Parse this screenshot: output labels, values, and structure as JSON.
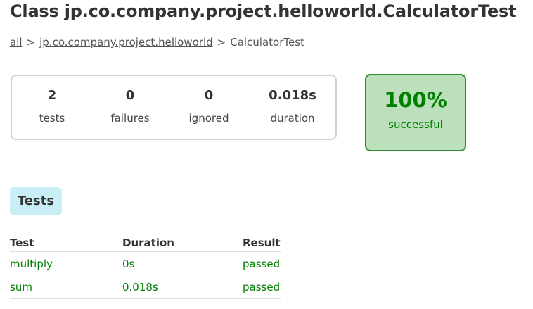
{
  "header": {
    "title": "Class jp.co.company.project.helloworld.CalculatorTest"
  },
  "breadcrumb": {
    "all": "all",
    "separator": ">",
    "package": "jp.co.company.project.helloworld",
    "current": "CalculatorTest"
  },
  "summary": {
    "counters": [
      {
        "value": "2",
        "label": "tests"
      },
      {
        "value": "0",
        "label": "failures"
      },
      {
        "value": "0",
        "label": "ignored"
      },
      {
        "value": "0.018s",
        "label": "duration"
      }
    ],
    "success": {
      "percent": "100%",
      "label": "successful"
    }
  },
  "tabs": [
    {
      "label": "Tests"
    }
  ],
  "table": {
    "headers": [
      "Test",
      "Duration",
      "Result"
    ],
    "rows": [
      {
        "test": "multiply",
        "duration": "0s",
        "result": "passed"
      },
      {
        "test": "sum",
        "duration": "0.018s",
        "result": "passed"
      }
    ]
  },
  "colors": {
    "success_text": "#008000",
    "success_bg": "#bbe0bb",
    "success_border": "#2e8b2e",
    "tab_bg": "#c8eef6",
    "box_border": "#d0d0d0"
  }
}
